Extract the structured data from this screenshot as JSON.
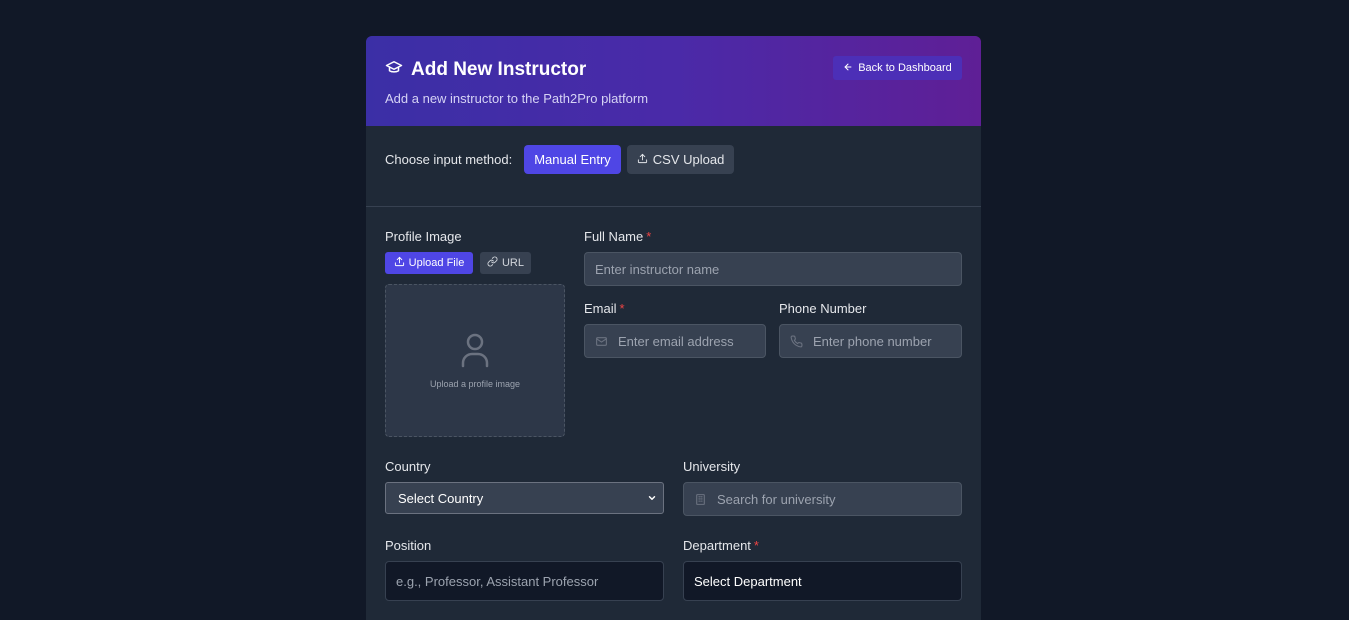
{
  "header": {
    "title": "Add New Instructor",
    "subtitle": "Add a new instructor to the Path2Pro platform",
    "back_label": "Back to Dashboard",
    "title_icon": "graduation-cap-icon"
  },
  "input_method": {
    "label": "Choose input method:",
    "options": [
      {
        "label": "Manual Entry",
        "active": true
      },
      {
        "label": "CSV Upload",
        "active": false
      }
    ]
  },
  "profile_image": {
    "label": "Profile Image",
    "upload_file_label": "Upload File",
    "url_label": "URL",
    "dropzone_text": "Upload a profile image"
  },
  "fields": {
    "full_name": {
      "label": "Full Name",
      "required": "*",
      "placeholder": "Enter instructor name"
    },
    "email": {
      "label": "Email",
      "required": "*",
      "placeholder": "Enter email address"
    },
    "phone": {
      "label": "Phone Number",
      "placeholder": "Enter phone number"
    },
    "country": {
      "label": "Country",
      "selected": "Select Country"
    },
    "university": {
      "label": "University",
      "placeholder": "Search for university"
    },
    "position": {
      "label": "Position",
      "placeholder": "e.g., Professor, Assistant Professor"
    },
    "department": {
      "label": "Department",
      "required": "*",
      "selected": "Select Department"
    }
  },
  "colors": {
    "background": "#111827",
    "card": "#1f2937",
    "accent": "#4f46e5",
    "required": "#ef4444"
  }
}
